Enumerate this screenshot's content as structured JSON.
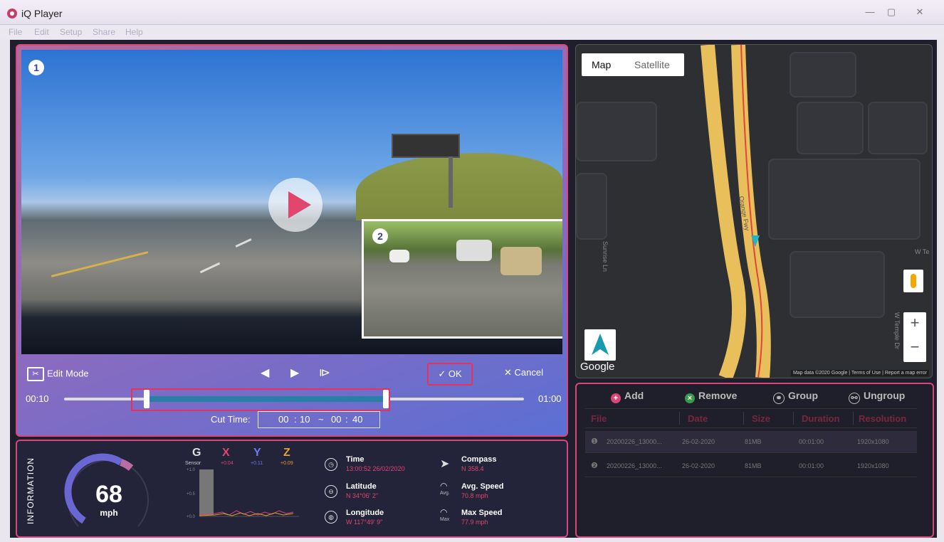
{
  "window": {
    "title": "iQ Player",
    "min": "—",
    "max": "▢",
    "close": "✕"
  },
  "menu": [
    "File",
    "Edit",
    "Setup",
    "Share",
    "Help"
  ],
  "video": {
    "cam1_badge": "1",
    "cam2_badge": "2"
  },
  "controls": {
    "edit_mode": "Edit Mode",
    "ok": "OK",
    "cancel": "Cancel",
    "start_time": "00:10",
    "end_time": "01:00",
    "cut_time_label": "Cut Time:",
    "cut_start_min": "00",
    "cut_start_sec": "10",
    "cut_sep": "~",
    "cut_end_min": "00",
    "cut_end_sec": "40",
    "range_start_fraction": 0.18,
    "range_end_fraction": 0.7
  },
  "info": {
    "panel_label": "INFORMATION",
    "speed": "68",
    "speed_unit": "mph",
    "sensor": {
      "g": "G",
      "g_sub": "Sensor",
      "x": "X",
      "x_val": "+0.04",
      "y": "Y",
      "y_val": "+0.11",
      "z": "Z",
      "z_val": "+0.09",
      "y_ticks": [
        "+1.0",
        "+0.5",
        "+0.0"
      ]
    },
    "time_title": "Time",
    "time_value": "13:00:52  26/02/2020",
    "lat_title": "Latitude",
    "lat_value": "N 34°06' 2\"",
    "lon_title": "Longitude",
    "lon_value": "W 117°49' 9\"",
    "compass_title": "Compass",
    "compass_value": "N    358.4",
    "avg_title": "Avg. Speed",
    "avg_sub": "Avg.",
    "avg_value": "70.8 mph",
    "max_title": "Max Speed",
    "max_sub": "Max",
    "max_value": "77.9 mph"
  },
  "map": {
    "tab_map": "Map",
    "tab_satellite": "Satellite",
    "road_label": "Orange Fwy",
    "street_1": "Sunrise Ln",
    "street_2": "W Temple Dr",
    "street_3": "W Te",
    "zoom_in": "+",
    "zoom_out": "−",
    "google": "Google",
    "attribution": "Map data ©2020 Google | Terms of Use | Report a map error"
  },
  "files": {
    "add": "Add",
    "remove": "Remove",
    "group": "Group",
    "ungroup": "Ungroup",
    "columns": [
      "File",
      "Date",
      "Size",
      "Duration",
      "Resolution"
    ],
    "rows": [
      {
        "idx": "❶",
        "file": "20200226_13000...",
        "date": "26-02-2020",
        "size": "81MB",
        "duration": "00:01:00",
        "resolution": "1920x1080"
      },
      {
        "idx": "❷",
        "file": "20200226_13000...",
        "date": "26-02-2020",
        "size": "81MB",
        "duration": "00:01:00",
        "resolution": "1920x1080"
      }
    ]
  },
  "colors": {
    "accent": "#d9467a",
    "panel": "#1f1e2d",
    "highlight": "#e3325e"
  }
}
